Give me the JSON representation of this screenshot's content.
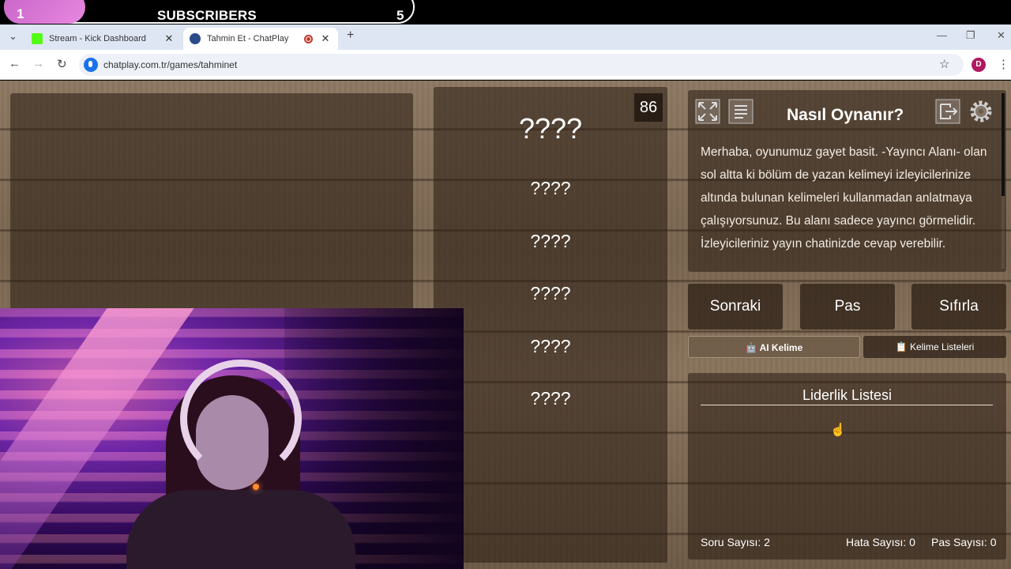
{
  "overlay": {
    "sub_count": "1",
    "title": "SUBSCRIBERS",
    "goal": "5"
  },
  "browser": {
    "tabs": [
      {
        "label": "Stream - Kick Dashboard",
        "favicon_color": "#53fc18"
      },
      {
        "label": "Tahmin Et - ChatPlay",
        "active": true
      }
    ],
    "url": "chatplay.com.tr/games/tahminet",
    "profile_initial": "D"
  },
  "game": {
    "timer": "86",
    "words": [
      "????",
      "????",
      "????",
      "????",
      "????",
      "????"
    ],
    "how_to_play": {
      "title": "Nasıl Oynanır?",
      "text": "Merhaba, oyunumuz gayet basit. -Yayıncı Alanı- olan sol altta ki bölüm de yazan kelimeyi izleyicilerinize altında bulunan kelimeleri kullanmadan anlatmaya çalışıyorsunuz. Bu alanı sadece yayıncı görmelidir. İzleyicileriniz yayın chatinizde cevap verebilir."
    },
    "buttons": {
      "next": "Sonraki",
      "pass": "Pas",
      "reset": "Sıfırla"
    },
    "ai_word": "AI Kelime",
    "word_lists": "Kelime Listeleri",
    "leaderboard": {
      "title": "Liderlik Listesi"
    },
    "stats": {
      "questions": "Soru Sayısı: 2",
      "errors": "Hata Sayısı: 0",
      "passes": "Pas Sayısı: 0"
    }
  }
}
